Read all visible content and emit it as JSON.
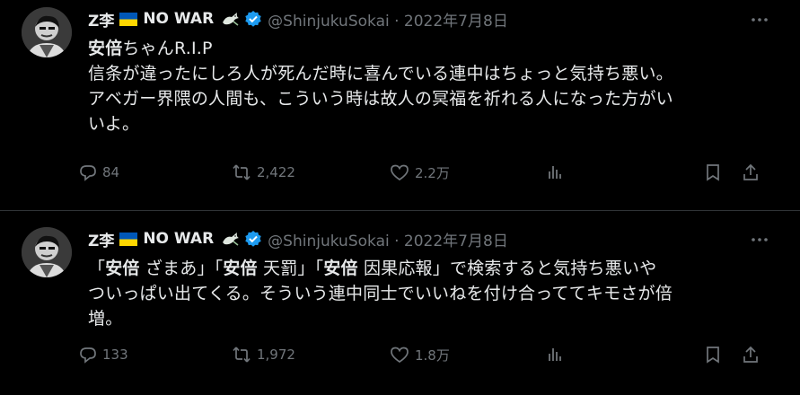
{
  "tweets": [
    {
      "author_name": "Z李",
      "author_tag": "NO WAR",
      "handle_date": "@ShinjukuSokai · 2022年7月8日",
      "line1_bold": "安倍",
      "line1_rest": "ちゃんR.I.P",
      "line2": "信条が違ったにしろ人が死んだ時に喜んでいる連中はちょっと気持ち悪い。",
      "line3": "アベガー界隈の人間も、こういう時は故人の冥福を祈れる人になった方がい",
      "line4": "いよ。",
      "replies": "84",
      "retweets": "2,422",
      "likes": "2.2万"
    },
    {
      "author_name": "Z李",
      "author_tag": "NO WAR",
      "handle_date": "@ShinjukuSokai · 2022年7月8日",
      "s1_open": "「",
      "s1_bold": "安倍",
      "s1_rest": " ざまあ」「",
      "s2_bold": "安倍",
      "s2_rest": " 天罰」「",
      "s3_bold": "安倍",
      "s3_rest": " 因果応報」で検索すると気持ち悪いや",
      "line2": "ついっぱい出てくる。そういう連中同士でいいねを付け合っててキモさが倍",
      "line3": "増。",
      "replies": "133",
      "retweets": "1,972",
      "likes": "1.8万"
    }
  ],
  "icons": {
    "more": "more-dots-icon",
    "reply": "reply-icon",
    "retweet": "retweet-icon",
    "like": "heart-icon",
    "views": "analytics-icon",
    "bookmark": "bookmark-icon",
    "share": "share-icon",
    "verified": "verified-badge-icon",
    "flag": "ukraine-flag-icon",
    "dove": "dove-icon"
  },
  "colors": {
    "background": "#000000",
    "text": "#e7e9ea",
    "muted": "#71767b",
    "verified": "#1d9bf0",
    "flag_blue": "#0057b7",
    "flag_yellow": "#ffd700",
    "divider": "#2f3336"
  }
}
